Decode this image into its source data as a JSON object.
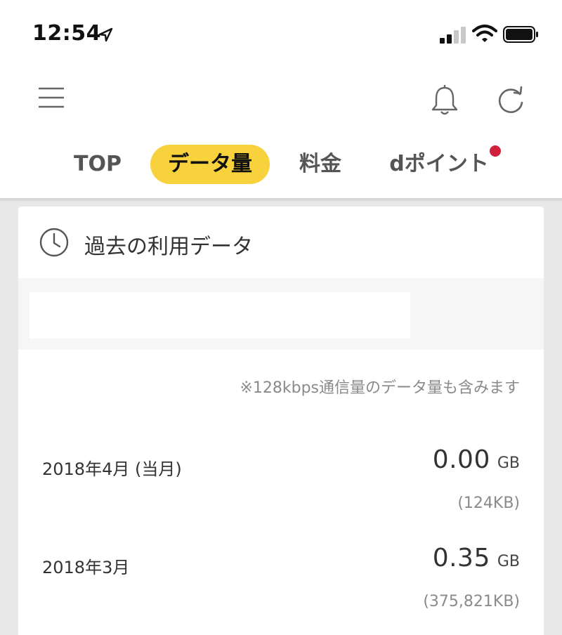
{
  "status_bar": {
    "time": "12:54"
  },
  "tabs": [
    {
      "label": "TOP"
    },
    {
      "label": "データ量"
    },
    {
      "label": "料金"
    },
    {
      "label": "dポイント"
    }
  ],
  "colors": {
    "accent": "#f7d23d",
    "notification": "#d0213c"
  },
  "card": {
    "title": "過去の利用データ",
    "note": "※128kbps通信量のデータ量も含みます",
    "rows": [
      {
        "month": "2018年4月 (当月)",
        "value": "0.00",
        "unit": "GB",
        "sub": "(124KB)"
      },
      {
        "month": "2018年3月",
        "value": "0.35",
        "unit": "GB",
        "sub": "(375,821KB)"
      }
    ]
  }
}
